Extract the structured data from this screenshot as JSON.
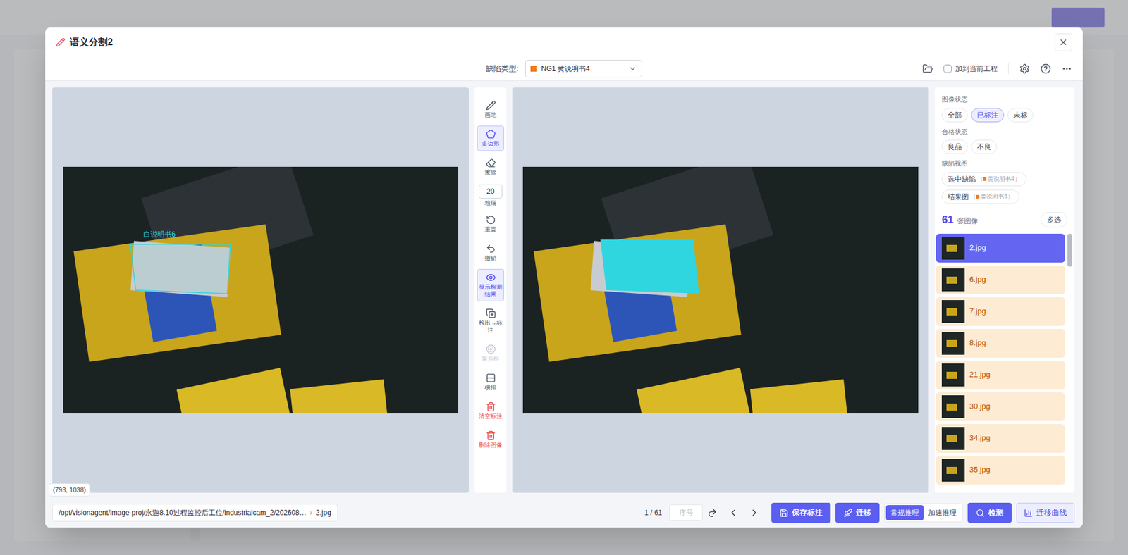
{
  "window": {
    "title": "语义分割2",
    "close": "×"
  },
  "toolbar": {
    "defect_label": "缺陷类型:",
    "defect_value": "NG1 黄说明书4",
    "defect_color": "#f47a1f",
    "add_to_project": {
      "label": "加到当前工程",
      "checked": false
    }
  },
  "tools": [
    {
      "label": "画笔",
      "kind": "tool",
      "selected": false,
      "disabled": false
    },
    {
      "label": "多边形",
      "kind": "tool",
      "selected": true,
      "disabled": false
    },
    {
      "label": "擦除",
      "kind": "tool",
      "selected": false,
      "disabled": false
    },
    {
      "label": "粗细",
      "kind": "thickness",
      "value": "20",
      "selected": false,
      "disabled": false
    },
    {
      "label": "重置",
      "kind": "tool",
      "selected": false,
      "disabled": false
    },
    {
      "label": "撤销",
      "kind": "tool",
      "selected": false,
      "disabled": false
    },
    {
      "label": "显示检测结果",
      "kind": "tool",
      "selected": true,
      "disabled": false
    },
    {
      "label": "检出→标注",
      "kind": "tool",
      "selected": false,
      "disabled": false
    },
    {
      "label": "聚焦框",
      "kind": "tool",
      "selected": false,
      "disabled": true
    },
    {
      "label": "横排",
      "kind": "tool",
      "selected": false,
      "disabled": false
    },
    {
      "label": "清空标注",
      "kind": "danger",
      "selected": false,
      "disabled": false
    },
    {
      "label": "删除图像",
      "kind": "danger",
      "selected": false,
      "disabled": false
    }
  ],
  "canvas": {
    "annotation_label": "白说明书6",
    "annotation_color": "#2fd6e0",
    "coords": "(793, 1038)"
  },
  "filters": [
    {
      "title": "图像状态",
      "options": [
        {
          "label": "全部",
          "selected": false
        },
        {
          "label": "已标注",
          "selected": true
        },
        {
          "label": "未标",
          "selected": false
        }
      ]
    },
    {
      "title": "合格状态",
      "options": [
        {
          "label": "良品",
          "selected": false
        },
        {
          "label": "不良",
          "selected": false
        }
      ]
    }
  ],
  "defect_view": {
    "title": "缺陷视图",
    "open": "（",
    "close": "）",
    "options": [
      {
        "label": "选中缺陷",
        "tag": "黄说明书4",
        "color": "#f47a1f"
      },
      {
        "label": "结果图",
        "tag": "黄说明书4",
        "color": "#f47a1f"
      }
    ]
  },
  "image_list": {
    "count": "61",
    "count_label": "张图像",
    "multi": "多选",
    "items": [
      {
        "name": "2.jpg",
        "selected": true
      },
      {
        "name": "6.jpg",
        "selected": false
      },
      {
        "name": "7.jpg",
        "selected": false
      },
      {
        "name": "8.jpg",
        "selected": false
      },
      {
        "name": "21.jpg",
        "selected": false
      },
      {
        "name": "30.jpg",
        "selected": false
      },
      {
        "name": "34.jpg",
        "selected": false
      },
      {
        "name": "35.jpg",
        "selected": false
      }
    ]
  },
  "status_bar": {
    "path": "/opt/visionagent/image-proj/永迦8.10过程监控后工位/industrialcam_2/202608…",
    "separator": "›",
    "file": "2.jpg",
    "page": "1 / 61",
    "index_placeholder": "序号",
    "save": "保存标注",
    "migrate": "迁移",
    "inference": [
      {
        "label": "常规推理",
        "selected": true
      },
      {
        "label": "加速推理",
        "selected": false
      }
    ],
    "detect": "检测",
    "curve": "迁移曲线"
  }
}
